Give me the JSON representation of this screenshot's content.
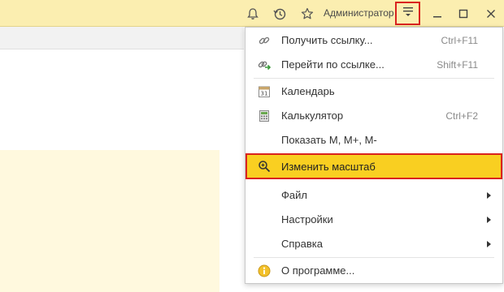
{
  "titlebar": {
    "user": "Администратор",
    "icons": [
      "bell-icon",
      "history-icon",
      "star-icon",
      "menu-icon",
      "minimize-icon",
      "maximize-icon",
      "close-icon"
    ]
  },
  "menu": {
    "items": [
      {
        "label": "Получить ссылку...",
        "shortcut": "Ctrl+F11",
        "icon": "link-icon"
      },
      {
        "label": "Перейти по ссылке...",
        "shortcut": "Shift+F11",
        "icon": "goto-link-icon"
      },
      {
        "label": "Календарь",
        "shortcut": "",
        "icon": "calendar-icon"
      },
      {
        "label": "Калькулятор",
        "shortcut": "Ctrl+F2",
        "icon": "calculator-icon"
      },
      {
        "label": "Показать M, M+, M-",
        "shortcut": "",
        "icon": ""
      },
      {
        "label": "Изменить масштаб",
        "shortcut": "",
        "icon": "zoom-icon",
        "highlighted": true
      },
      {
        "label": "Файл",
        "shortcut": "",
        "icon": "",
        "submenu": true
      },
      {
        "label": "Настройки",
        "shortcut": "",
        "icon": "",
        "submenu": true
      },
      {
        "label": "Справка",
        "shortcut": "",
        "icon": "",
        "submenu": true
      },
      {
        "label": "О программе...",
        "shortcut": "",
        "icon": "info-icon"
      }
    ]
  },
  "colors": {
    "titlebar": "#fbeeb0",
    "highlight": "#f9cf21",
    "annotation": "#d9231f"
  }
}
